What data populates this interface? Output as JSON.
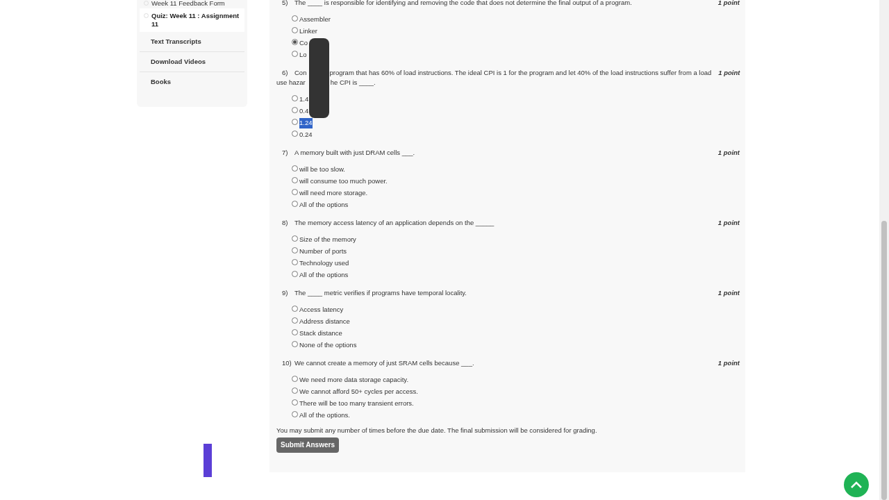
{
  "sidebar": {
    "items": [
      {
        "label": "Week 11 Feedback Form",
        "kind": "lesson",
        "selected": false
      },
      {
        "label": "Quiz: Week 11 : Assignment 11",
        "kind": "lesson",
        "selected": true
      },
      {
        "label": "Text Transcripts",
        "kind": "section",
        "selected": false
      },
      {
        "label": "Download Videos",
        "kind": "section",
        "selected": false
      },
      {
        "label": "Books",
        "kind": "section",
        "selected": false
      }
    ]
  },
  "questions": [
    {
      "number": "5)",
      "lines": [
        [
          "The ____ is responsible for identifying and removing the code that does not determine the final output of a program."
        ]
      ],
      "points": "1 point",
      "options": [
        {
          "parts": [
            "Assembler"
          ],
          "selected": false,
          "highlighted": false
        },
        {
          "parts": [
            "Linker"
          ],
          "selected": false,
          "highlighted": false
        },
        {
          "parts": [
            "Co"
          ],
          "selected": true,
          "highlighted": false
        },
        {
          "parts": [
            "Lo"
          ],
          "selected": false,
          "highlighted": false
        }
      ]
    },
    {
      "number": "6)",
      "lines": [
        [
          "Con",
          "program that has 60% of load instructions. The ideal CPI is 1 for the program and let 40% of the load instructions suffer from a load"
        ],
        [
          "use hazar",
          "he CPI is ____."
        ]
      ],
      "points": "1 point",
      "options": [
        {
          "parts": [
            "1.4"
          ],
          "selected": false,
          "highlighted": false
        },
        {
          "parts": [
            "0.4"
          ],
          "selected": false,
          "highlighted": false
        },
        {
          "parts": [
            "1.24"
          ],
          "selected": false,
          "highlighted": true
        },
        {
          "parts": [
            "0.24"
          ],
          "selected": false,
          "highlighted": false
        }
      ]
    },
    {
      "number": "7)",
      "lines": [
        [
          "A memory built with just DRAM cells ___."
        ]
      ],
      "points": "1 point",
      "options": [
        {
          "parts": [
            "will be too slow."
          ],
          "selected": false,
          "highlighted": false
        },
        {
          "parts": [
            "will consume too much power."
          ],
          "selected": false,
          "highlighted": false
        },
        {
          "parts": [
            "will need more storage."
          ],
          "selected": false,
          "highlighted": false
        },
        {
          "parts": [
            "All of the options"
          ],
          "selected": false,
          "highlighted": false
        }
      ]
    },
    {
      "number": "8)",
      "lines": [
        [
          "The memory access latency of an application depends on the _____"
        ]
      ],
      "points": "1 point",
      "options": [
        {
          "parts": [
            "Size of the memory"
          ],
          "selected": false,
          "highlighted": false
        },
        {
          "parts": [
            "Number of ports"
          ],
          "selected": false,
          "highlighted": false
        },
        {
          "parts": [
            "Technology used"
          ],
          "selected": false,
          "highlighted": false
        },
        {
          "parts": [
            "All of the options"
          ],
          "selected": false,
          "highlighted": false
        }
      ]
    },
    {
      "number": "9)",
      "lines": [
        [
          "The ____ metric verifies if programs have temporal locality."
        ]
      ],
      "points": "1 point",
      "options": [
        {
          "parts": [
            "Access latency"
          ],
          "selected": false,
          "highlighted": false
        },
        {
          "parts": [
            "Address distance"
          ],
          "selected": false,
          "highlighted": false
        },
        {
          "parts": [
            "Stack distance"
          ],
          "selected": false,
          "highlighted": false
        },
        {
          "parts": [
            "None of the options"
          ],
          "selected": false,
          "highlighted": false
        }
      ]
    },
    {
      "number": "10)",
      "lines": [
        [
          "We cannot create a memory of just SRAM cells because ___."
        ]
      ],
      "points": "1 point",
      "options": [
        {
          "parts": [
            "We need more data storage capacity."
          ],
          "selected": false,
          "highlighted": false
        },
        {
          "parts": [
            "We cannot afford 50+ cycles per access."
          ],
          "selected": false,
          "highlighted": false
        },
        {
          "parts": [
            "There will be too many transient errors."
          ],
          "selected": false,
          "highlighted": false
        },
        {
          "parts": [
            "All of the options."
          ],
          "selected": false,
          "highlighted": false
        }
      ]
    }
  ],
  "note": "You may submit any number of times before the due date. The final submission will be considered for grading.",
  "submit_button": "Submit Answers"
}
